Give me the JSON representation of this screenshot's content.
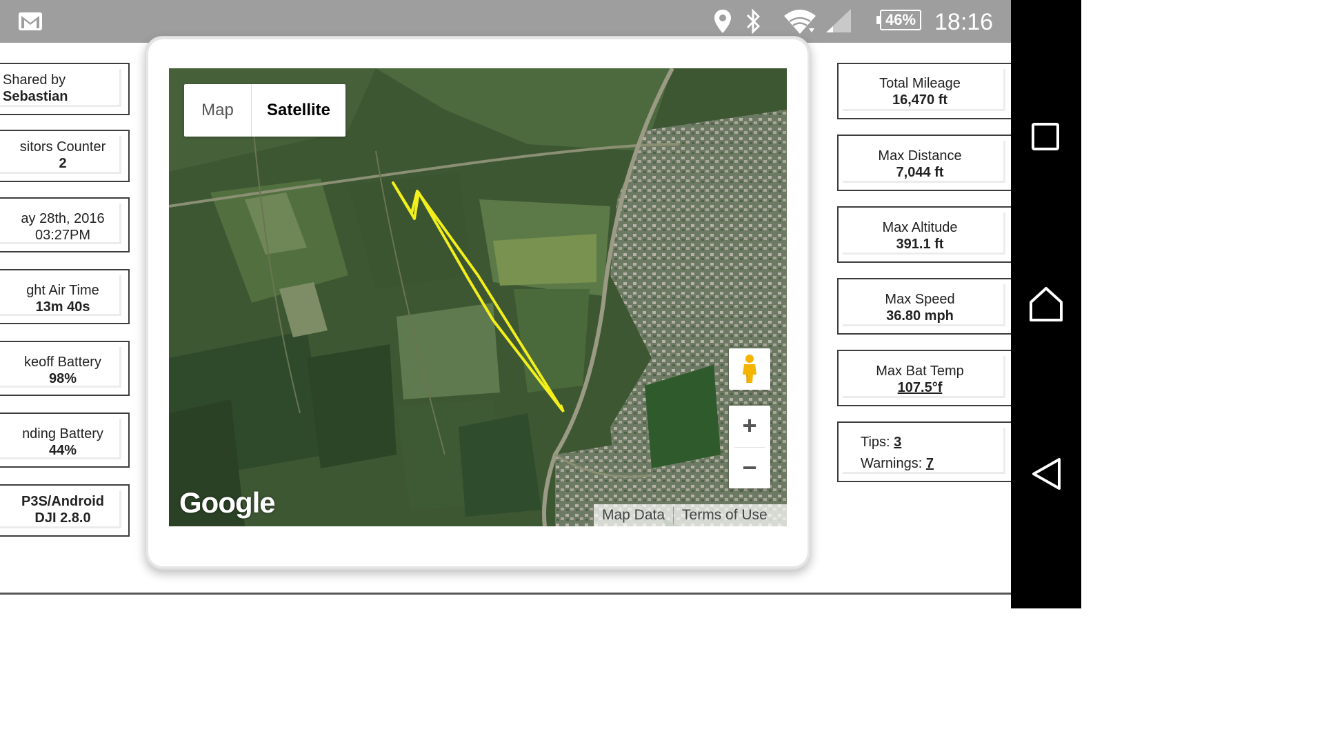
{
  "status_bar": {
    "battery_text": "46%",
    "time": "18:16"
  },
  "left_cards": [
    {
      "line1": "Shared by",
      "line2": "Sebastian"
    },
    {
      "line1": "sitors Counter",
      "line2": "2"
    },
    {
      "line1": "ay 28th, 2016",
      "line2": "03:27PM"
    },
    {
      "line1": "ght Air Time",
      "line2": "13m 40s"
    },
    {
      "line1": "keoff Battery",
      "line2": "98%"
    },
    {
      "line1": "nding Battery",
      "line2": "44%"
    },
    {
      "line1": "P3S/Android",
      "line2": "DJI 2.8.0"
    }
  ],
  "right_cards": [
    {
      "label": "Total Mileage",
      "value": "16,470 ft"
    },
    {
      "label": "Max Distance",
      "value": "7,044 ft"
    },
    {
      "label": "Max Altitude",
      "value": "391.1 ft"
    },
    {
      "label": "Max Speed",
      "value": "36.80 mph"
    },
    {
      "label": "Max Bat Temp",
      "value": "107.5°f"
    }
  ],
  "tips_card": {
    "tips_label": "Tips: ",
    "tips_value": "3",
    "warnings_label": "Warnings: ",
    "warnings_value": "7"
  },
  "map": {
    "toggle_map": "Map",
    "toggle_satellite": "Satellite",
    "zoom_in": "+",
    "zoom_out": "−",
    "logo": "Google",
    "map_data": "Map Data",
    "terms": "Terms of Use",
    "flight_path_color": "#f2ef1a"
  }
}
